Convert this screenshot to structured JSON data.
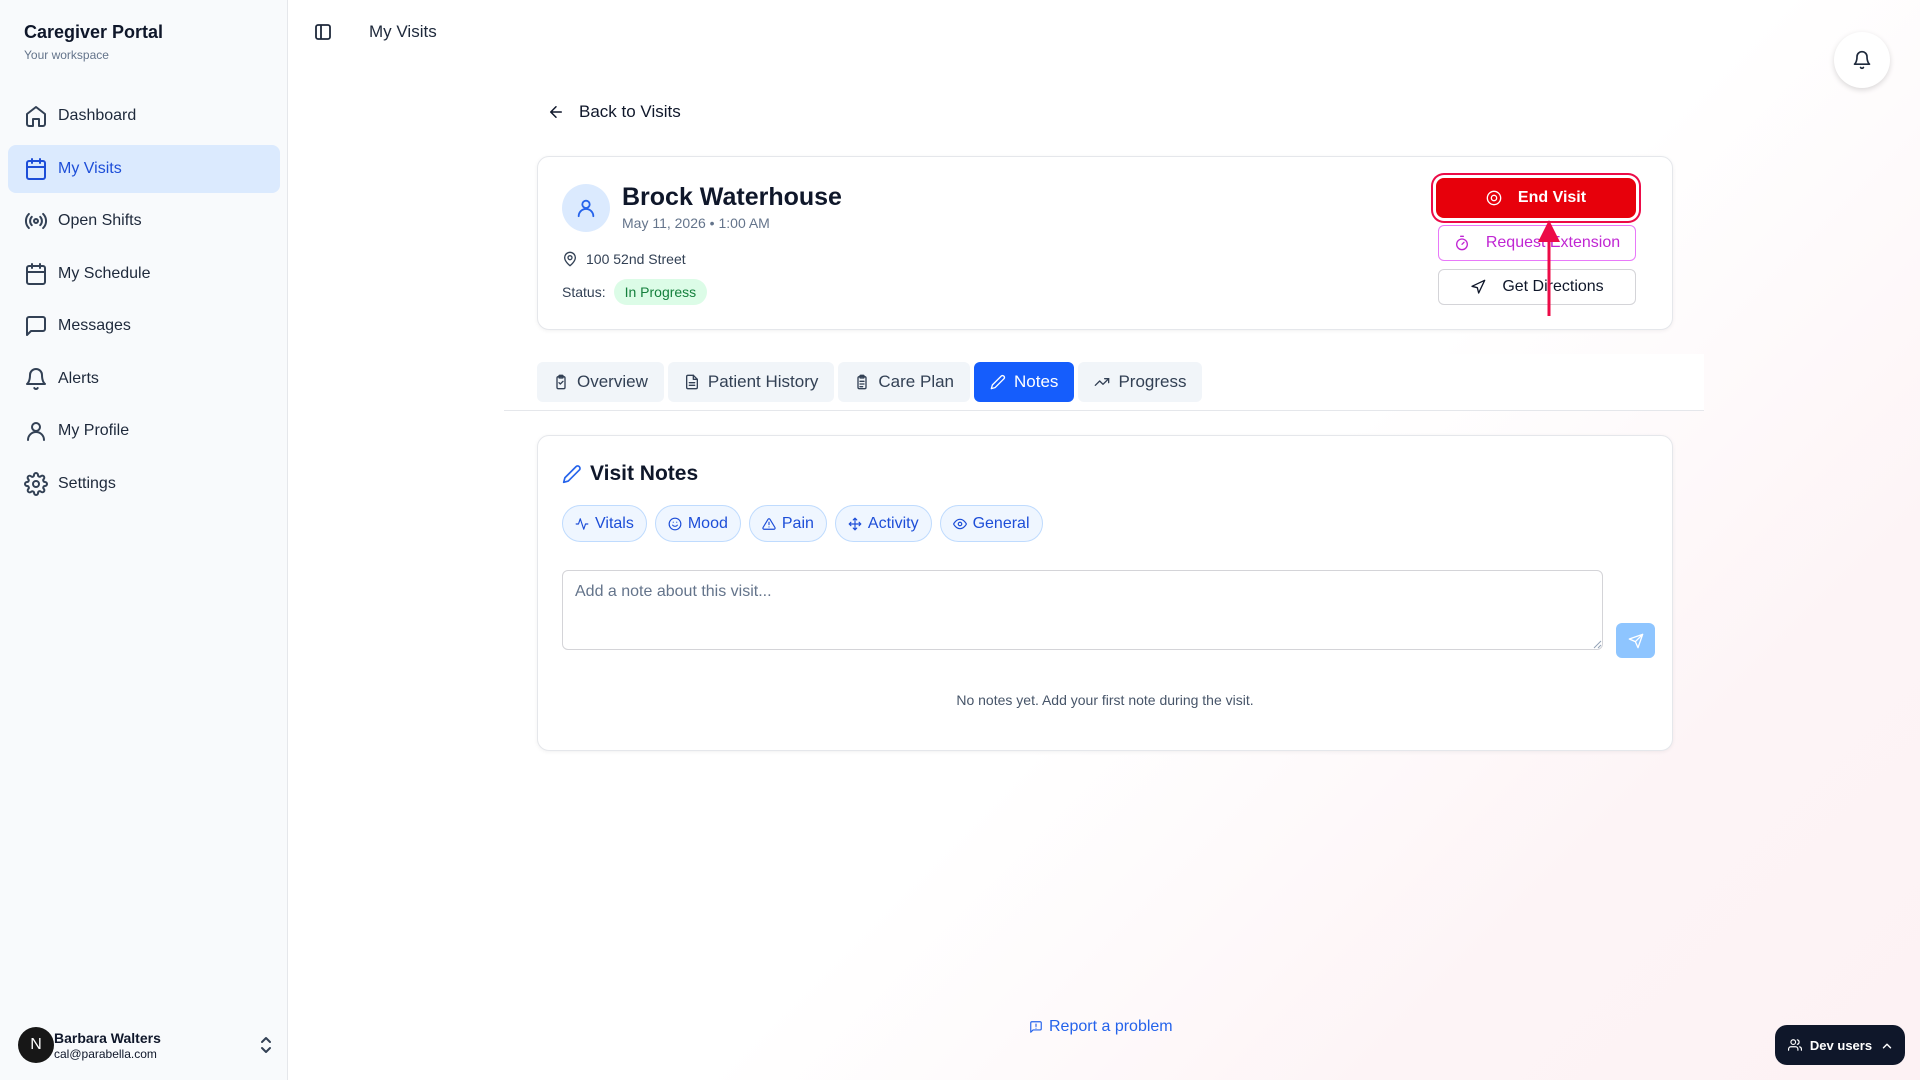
{
  "sidebar": {
    "title": "Caregiver Portal",
    "subtitle": "Your workspace",
    "items": [
      {
        "label": "Dashboard",
        "icon": "home-icon"
      },
      {
        "label": "My Visits",
        "icon": "calendar-icon",
        "active": true
      },
      {
        "label": "Open Shifts",
        "icon": "broadcast-icon"
      },
      {
        "label": "My Schedule",
        "icon": "calendar-icon"
      },
      {
        "label": "Messages",
        "icon": "message-icon"
      },
      {
        "label": "Alerts",
        "icon": "bell-icon"
      },
      {
        "label": "My Profile",
        "icon": "user-icon"
      },
      {
        "label": "Settings",
        "icon": "gear-icon"
      }
    ],
    "user": {
      "initial": "N",
      "name": "Barbara Walters",
      "email": "cal@parabella.com"
    }
  },
  "topbar": {
    "title": "My Visits"
  },
  "back_link": "Back to Visits",
  "visit": {
    "patient_name": "Brock Waterhouse",
    "datetime": "May 11, 2026 • 1:00 AM",
    "address": "100 52nd Street",
    "status_label": "Status:",
    "status": "In Progress",
    "actions": {
      "end_visit": "End Visit",
      "request_extension": "Request Extension",
      "get_directions": "Get Directions"
    }
  },
  "tabs": [
    {
      "label": "Overview",
      "icon": "clipboard-icon"
    },
    {
      "label": "Patient History",
      "icon": "document-icon"
    },
    {
      "label": "Care Plan",
      "icon": "clipboard-list-icon"
    },
    {
      "label": "Notes",
      "icon": "pencil-icon",
      "active": true
    },
    {
      "label": "Progress",
      "icon": "trending-up-icon"
    }
  ],
  "notes": {
    "title": "Visit Notes",
    "categories": [
      {
        "label": "Vitals",
        "icon": "activity-icon"
      },
      {
        "label": "Mood",
        "icon": "smile-icon"
      },
      {
        "label": "Pain",
        "icon": "warning-icon"
      },
      {
        "label": "Activity",
        "icon": "move-icon"
      },
      {
        "label": "General",
        "icon": "eye-icon"
      }
    ],
    "input_placeholder": "Add a note about this visit...",
    "empty_message": "No notes yet. Add your first note during the visit."
  },
  "footer": {
    "report_link": "Report a problem"
  },
  "dev_users": {
    "label": "Dev users"
  },
  "colors": {
    "accent": "#155dfc",
    "danger": "#e7000b",
    "highlight": "#ec0b47",
    "extension": "#c026d3",
    "status_bg": "#dcfce7",
    "status_text": "#15803d"
  }
}
